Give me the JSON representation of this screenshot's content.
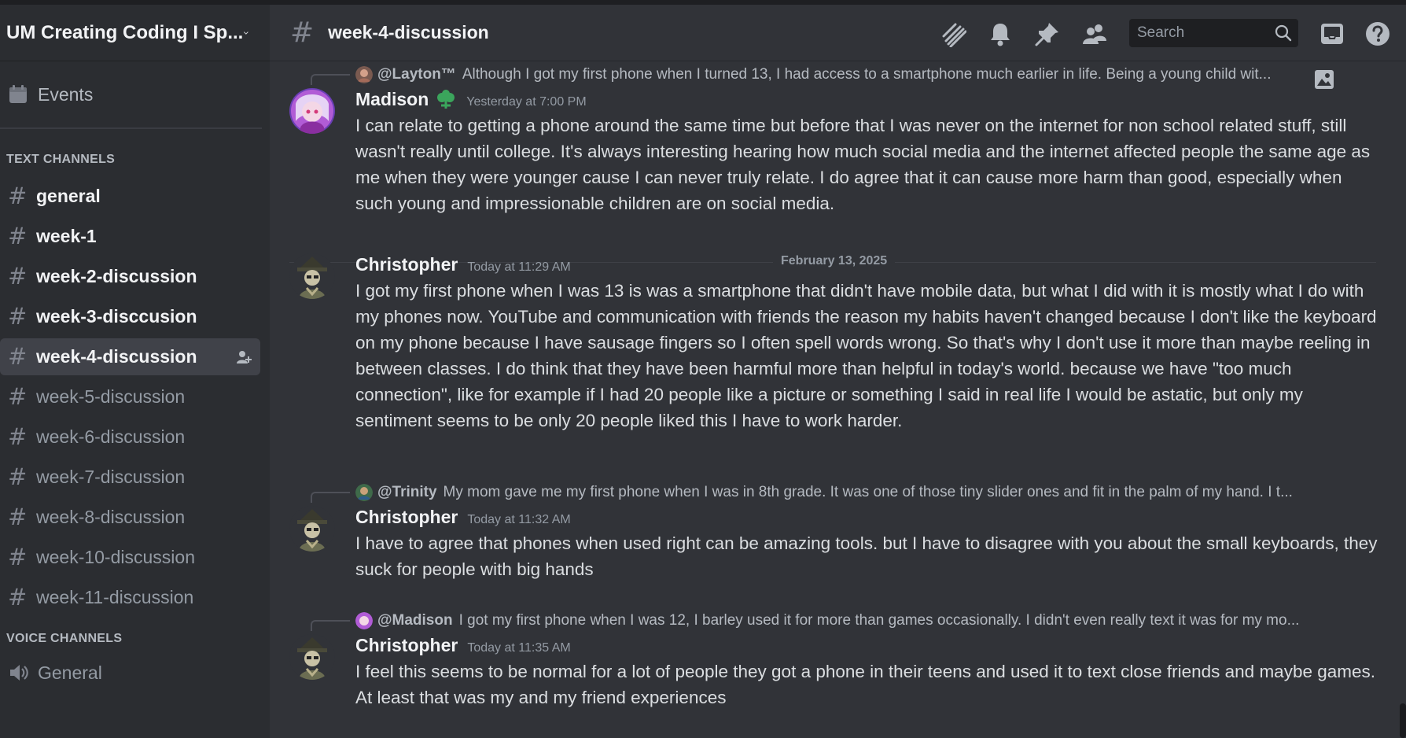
{
  "server": {
    "name": "UM Creating Coding I Sp..."
  },
  "sidebar": {
    "events_label": "Events",
    "text_category": "TEXT CHANNELS",
    "voice_category": "VOICE CHANNELS",
    "channels": [
      {
        "name": "general"
      },
      {
        "name": "week-1"
      },
      {
        "name": "week-2-discussion"
      },
      {
        "name": "week-3-disccusion"
      },
      {
        "name": "week-4-discussion"
      },
      {
        "name": "week-5-discussion"
      },
      {
        "name": "week-6-discussion"
      },
      {
        "name": "week-7-discussion"
      },
      {
        "name": "week-8-discussion"
      },
      {
        "name": "week-10-discussion"
      },
      {
        "name": "week-11-discussion"
      }
    ],
    "voice_channels": [
      {
        "name": "General"
      }
    ]
  },
  "header": {
    "channel_title": "week-4-discussion",
    "search_placeholder": "Search"
  },
  "messages": [
    {
      "reply_to": {
        "name": "@Layton™",
        "text": "Although I got my first phone when I turned 13, I had access to a smartphone much earlier in life. Being a young child wit..."
      },
      "author": "Madison",
      "timestamp": "Yesterday at 7:00 PM",
      "text": "I can relate to getting a phone around the same time but before that I was never on the internet for non school related stuff, still wasn't really until college. It's always interesting hearing how much social media and the internet affected people the same age as me when they were younger cause I can never truly relate. I do agree that it can cause more harm than good, especially when such young and impressionable children are on social media."
    },
    {
      "author": "Christopher",
      "timestamp": "Today at 11:29 AM",
      "text": "I got my first phone when I was 13 is was a smartphone that didn't have mobile data, but what I did with it is mostly what I do with my phones now. YouTube and communication with friends the reason my habits haven't changed because I don't like the keyboard on my phone because I have sausage fingers so I often spell words wrong. So that's why I don't use it more than maybe reeling in between classes. I do think that they have been harmful more than helpful in today's world. because we have \"too much connection\", like for example if I had 20 people like a picture or something I said in real life I would be astatic, but only my sentiment seems to be only 20 people liked this I have to work harder."
    },
    {
      "reply_to": {
        "name": "@Trinity",
        "text": "My mom gave me my first phone when I was in 8th grade. It was one of those tiny slider ones and fit in the palm of my hand. I t..."
      },
      "author": "Christopher",
      "timestamp": "Today at 11:32 AM",
      "text": "I have to agree that phones when used right can be amazing tools. but I have to disagree with you about the small keyboards, they suck for people with big hands"
    },
    {
      "reply_to": {
        "name": "@Madison",
        "text": "I got my first phone when I was 12, I barley used it for more than games occasionally. I didn't even really text it was for my mo..."
      },
      "author": "Christopher",
      "timestamp": "Today at 11:35 AM",
      "text": "I feel this seems to be normal for a lot of people they got a phone in their teens and used it to text close friends and maybe games. At least that was my and my friend experiences"
    }
  ],
  "date_divider": "February 13, 2025",
  "colors": {
    "background": "#313338",
    "sidebar": "#2b2d31",
    "active_channel": "#404249",
    "badge_green": "#3ba55c"
  }
}
